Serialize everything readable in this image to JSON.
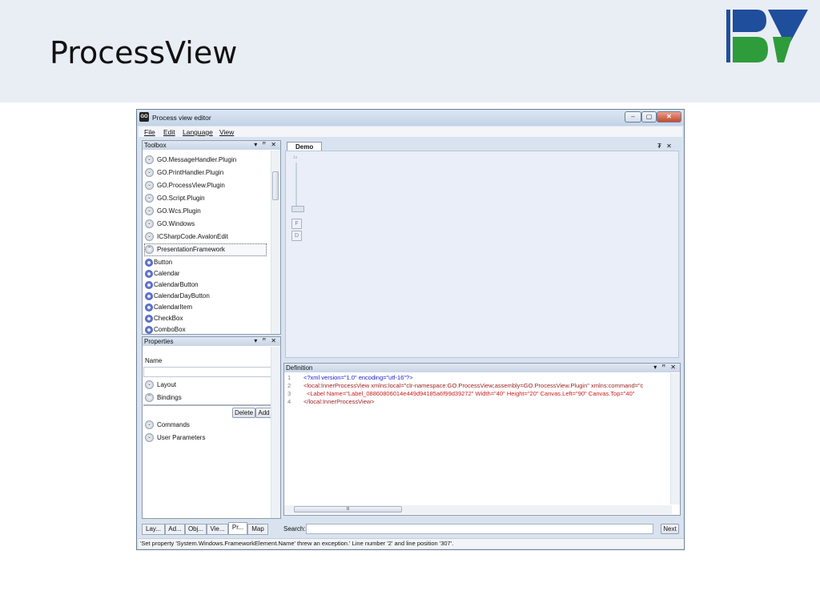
{
  "slide": {
    "title": "ProcessView"
  },
  "colors": {
    "logo_blue": "#1f4e9c",
    "logo_green": "#2e9c3a"
  },
  "window": {
    "app_icon": "GO",
    "title": "Process view editor",
    "controls": {
      "minimize": "–",
      "maximize": "▢",
      "close": "✕"
    }
  },
  "menu": [
    "File",
    "Edit",
    "Language",
    "View"
  ],
  "toolbox": {
    "title": "Toolbox",
    "controls": "▾ ꟸ ✕",
    "groups": [
      "GO.MessageHandler.Plugin",
      "GO.PrintHandler.Plugin",
      "GO.ProcessView.Plugin",
      "GO.Script.Plugin",
      "GO.Wcs.Plugin",
      "GO.Windows",
      "ICSharpCode.AvalonEdit",
      "PresentationFramework"
    ],
    "items": [
      "Button",
      "Calendar",
      "CalendarButton",
      "CalendarDayButton",
      "CalendarItem",
      "CheckBox",
      "ComboBox"
    ]
  },
  "properties": {
    "title": "Properties",
    "controls": "▾ ꟸ ✕",
    "name_label": "Name",
    "name_value": "",
    "sections": [
      "Layout",
      "Bindings",
      "Commands",
      "User Parameters"
    ],
    "delete_label": "Delete",
    "add_label": "Add"
  },
  "demo": {
    "tab_label": "Demo",
    "controls": "₮ ✕",
    "zoom_label": "1x",
    "btn_f": "F",
    "btn_d": "D"
  },
  "definition": {
    "title": "Definition",
    "controls": "▾ ꟸ ✕",
    "lines": [
      {
        "n": "1",
        "text": "<?xml version=\"1.0\" encoding=\"utf-16\"?>"
      },
      {
        "n": "2",
        "text": "<local:InnerProcessView xmlns:local=\"clr-namespace:GO.ProcessView;assembly=GO.ProcessView.Plugin\" xmlns:command=\"c"
      },
      {
        "n": "3",
        "text": "<Label Name=\"Label_08860806014e449d94185a6f99d39272\" Width=\"40\" Height=\"20\" Canvas.Left=\"90\" Canvas.Top=\"40\""
      },
      {
        "n": "4",
        "text": "</local:InnerProcessView>"
      }
    ],
    "hscroll_glyph": "III"
  },
  "search": {
    "label": "Search:",
    "value": "",
    "next_label": "Next"
  },
  "bottom_tabs": [
    "Lay...",
    "Ad...",
    "Obj...",
    "Vie...",
    "Pr...",
    "Map"
  ],
  "status": "'Set property 'System.Windows.FrameworkElement.Name' threw an exception.' Line number '2' and line position '307'."
}
